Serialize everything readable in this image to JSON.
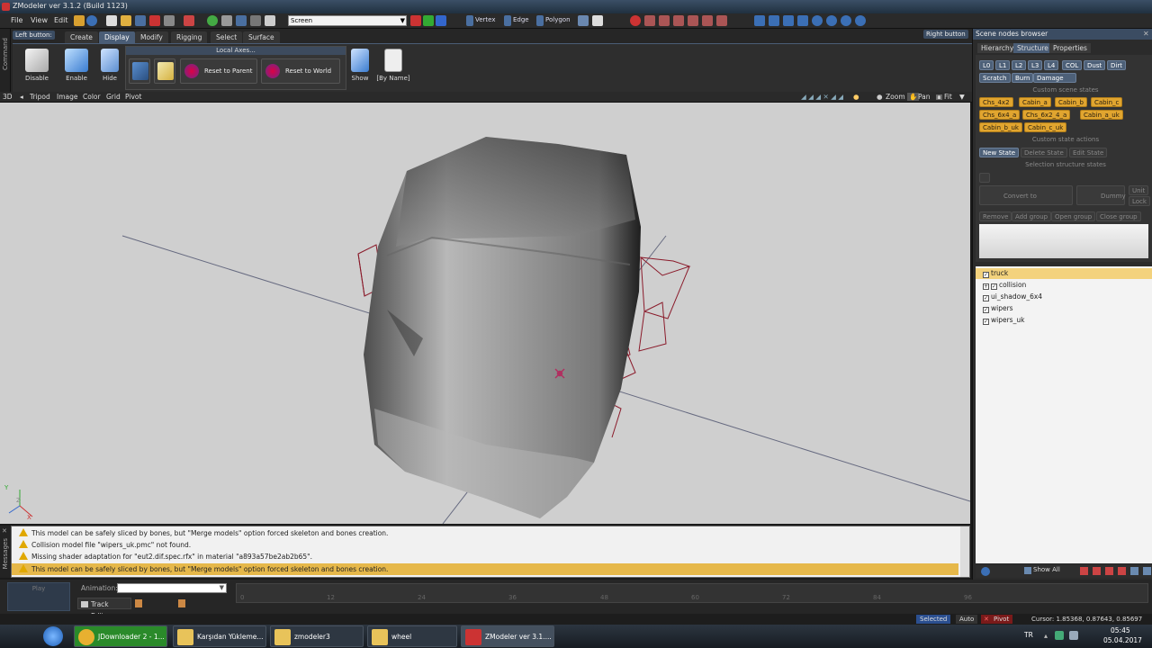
{
  "window": {
    "title": "ZModeler ver 3.1.2 (Build 1123)"
  },
  "menu": [
    "File",
    "View",
    "Edit"
  ],
  "toolbar": {
    "select_value": "Screen",
    "modes": [
      "Vertex",
      "Edge",
      "Polygon"
    ]
  },
  "left_strip_label": "Command",
  "ribbon": {
    "left_button_label": "Left button:",
    "tabs": [
      "Create",
      "Display",
      "Modify",
      "Rigging",
      "Select",
      "Surface"
    ],
    "active_tab": "Display",
    "buttons": {
      "disable": "Disable",
      "enable": "Enable",
      "hide": "Hide",
      "show": "Show",
      "by_name": "[By Name]"
    },
    "local_axes": {
      "header": "Local Axes...",
      "reset_parent": "Reset to Parent",
      "reset_world": "Reset to World"
    }
  },
  "right_button_label": "Right button",
  "viewport_bar": {
    "mode": "3D",
    "items": [
      "Tripod",
      "Image",
      "Color",
      "Grid",
      "Pivot"
    ],
    "zoom": "Zoom",
    "pan": "Pan",
    "fit": "Fit"
  },
  "scene_nodes": {
    "title": "Scene nodes browser",
    "tabs": [
      "Hierarchy",
      "Structure",
      "Properties"
    ],
    "active_tab": "Structure",
    "state_buttons": [
      "L0",
      "L1",
      "L2",
      "L3",
      "L4",
      "COL",
      "Dust",
      "Dirt",
      "Scratch",
      "Burn",
      "Damage"
    ],
    "custom_scene_states_label": "Custom scene states",
    "custom_states": [
      "Chs_4x2",
      "Cabin_a",
      "Cabin_b",
      "Cabin_c",
      "Chs_6x4_a",
      "Chs_6x2_4_a",
      "Cabin_a_uk",
      "Cabin_b_uk",
      "Cabin_c_uk"
    ],
    "custom_state_actions_label": "Custom state actions",
    "actions": [
      "New State",
      "Delete State",
      "Edit State"
    ],
    "selection_structure_label": "Selection structure states",
    "structure_buttons": [
      "Convert to Compound",
      "Dummy",
      "Unit",
      "Lock",
      "Remove",
      "Add group",
      "Open group",
      "Close group"
    ],
    "tree": [
      {
        "name": "truck",
        "level": 0
      },
      {
        "name": "collision",
        "level": 1
      },
      {
        "name": "ui_shadow_6x4",
        "level": 0
      },
      {
        "name": "wipers",
        "level": 0
      },
      {
        "name": "wipers_uk",
        "level": 0
      }
    ],
    "show_all": "Show All"
  },
  "messages_label": "Messages",
  "messages": [
    "This model can be safely sliced by bones, but \"Merge models\" option forced skeleton and bones creation.",
    "Collision model file \"wipers_uk.pmc\" not found.",
    "Missing shader adaptation for \"eut2.dif.spec.rfx\" in material \"a893a57be2ab2b65\".",
    "This model can be safely sliced by bones, but \"Merge models\" option forced skeleton and bones creation."
  ],
  "animation": {
    "play": "Play",
    "label": "Animation:",
    "track_editor": "Track Editor",
    "ticks": [
      "0",
      "12",
      "24",
      "36",
      "48",
      "60",
      "72",
      "84",
      "96"
    ]
  },
  "status": {
    "selected": "Selected",
    "auto": "Auto",
    "pivot": "Pivot",
    "cursor": "Cursor: 1.85368, 0.87643, 0.85697"
  },
  "taskbar": {
    "tasks": [
      "JDownloader 2 - 1...",
      "Karşıdan Yükleme...",
      "zmodeler3",
      "wheel",
      "ZModeler ver 3.1...."
    ],
    "lang": "TR",
    "time": "05:45",
    "date": "05.04.2017"
  },
  "colors": {
    "accent": "#4a5d76",
    "highlight": "#e6b84a",
    "state_orange": "#e1a52f",
    "viewport": "#cfcfcf"
  }
}
